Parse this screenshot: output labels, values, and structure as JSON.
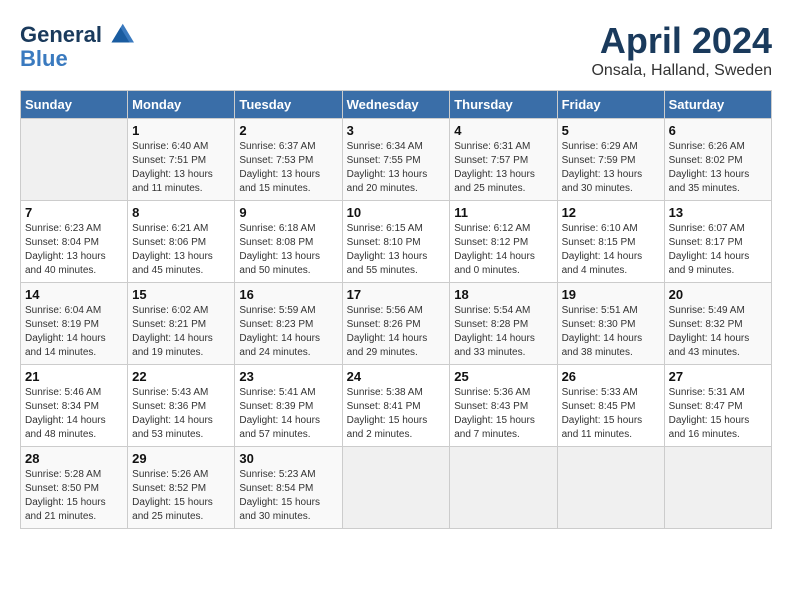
{
  "header": {
    "logo_line1": "General",
    "logo_line2": "Blue",
    "title": "April 2024",
    "location": "Onsala, Halland, Sweden"
  },
  "days_of_week": [
    "Sunday",
    "Monday",
    "Tuesday",
    "Wednesday",
    "Thursday",
    "Friday",
    "Saturday"
  ],
  "weeks": [
    [
      {
        "day": "",
        "sunrise": "",
        "sunset": "",
        "daylight": ""
      },
      {
        "day": "1",
        "sunrise": "6:40 AM",
        "sunset": "7:51 PM",
        "daylight": "13 hours and 11 minutes."
      },
      {
        "day": "2",
        "sunrise": "6:37 AM",
        "sunset": "7:53 PM",
        "daylight": "13 hours and 15 minutes."
      },
      {
        "day": "3",
        "sunrise": "6:34 AM",
        "sunset": "7:55 PM",
        "daylight": "13 hours and 20 minutes."
      },
      {
        "day": "4",
        "sunrise": "6:31 AM",
        "sunset": "7:57 PM",
        "daylight": "13 hours and 25 minutes."
      },
      {
        "day": "5",
        "sunrise": "6:29 AM",
        "sunset": "7:59 PM",
        "daylight": "13 hours and 30 minutes."
      },
      {
        "day": "6",
        "sunrise": "6:26 AM",
        "sunset": "8:02 PM",
        "daylight": "13 hours and 35 minutes."
      }
    ],
    [
      {
        "day": "7",
        "sunrise": "6:23 AM",
        "sunset": "8:04 PM",
        "daylight": "13 hours and 40 minutes."
      },
      {
        "day": "8",
        "sunrise": "6:21 AM",
        "sunset": "8:06 PM",
        "daylight": "13 hours and 45 minutes."
      },
      {
        "day": "9",
        "sunrise": "6:18 AM",
        "sunset": "8:08 PM",
        "daylight": "13 hours and 50 minutes."
      },
      {
        "day": "10",
        "sunrise": "6:15 AM",
        "sunset": "8:10 PM",
        "daylight": "13 hours and 55 minutes."
      },
      {
        "day": "11",
        "sunrise": "6:12 AM",
        "sunset": "8:12 PM",
        "daylight": "14 hours and 0 minutes."
      },
      {
        "day": "12",
        "sunrise": "6:10 AM",
        "sunset": "8:15 PM",
        "daylight": "14 hours and 4 minutes."
      },
      {
        "day": "13",
        "sunrise": "6:07 AM",
        "sunset": "8:17 PM",
        "daylight": "14 hours and 9 minutes."
      }
    ],
    [
      {
        "day": "14",
        "sunrise": "6:04 AM",
        "sunset": "8:19 PM",
        "daylight": "14 hours and 14 minutes."
      },
      {
        "day": "15",
        "sunrise": "6:02 AM",
        "sunset": "8:21 PM",
        "daylight": "14 hours and 19 minutes."
      },
      {
        "day": "16",
        "sunrise": "5:59 AM",
        "sunset": "8:23 PM",
        "daylight": "14 hours and 24 minutes."
      },
      {
        "day": "17",
        "sunrise": "5:56 AM",
        "sunset": "8:26 PM",
        "daylight": "14 hours and 29 minutes."
      },
      {
        "day": "18",
        "sunrise": "5:54 AM",
        "sunset": "8:28 PM",
        "daylight": "14 hours and 33 minutes."
      },
      {
        "day": "19",
        "sunrise": "5:51 AM",
        "sunset": "8:30 PM",
        "daylight": "14 hours and 38 minutes."
      },
      {
        "day": "20",
        "sunrise": "5:49 AM",
        "sunset": "8:32 PM",
        "daylight": "14 hours and 43 minutes."
      }
    ],
    [
      {
        "day": "21",
        "sunrise": "5:46 AM",
        "sunset": "8:34 PM",
        "daylight": "14 hours and 48 minutes."
      },
      {
        "day": "22",
        "sunrise": "5:43 AM",
        "sunset": "8:36 PM",
        "daylight": "14 hours and 53 minutes."
      },
      {
        "day": "23",
        "sunrise": "5:41 AM",
        "sunset": "8:39 PM",
        "daylight": "14 hours and 57 minutes."
      },
      {
        "day": "24",
        "sunrise": "5:38 AM",
        "sunset": "8:41 PM",
        "daylight": "15 hours and 2 minutes."
      },
      {
        "day": "25",
        "sunrise": "5:36 AM",
        "sunset": "8:43 PM",
        "daylight": "15 hours and 7 minutes."
      },
      {
        "day": "26",
        "sunrise": "5:33 AM",
        "sunset": "8:45 PM",
        "daylight": "15 hours and 11 minutes."
      },
      {
        "day": "27",
        "sunrise": "5:31 AM",
        "sunset": "8:47 PM",
        "daylight": "15 hours and 16 minutes."
      }
    ],
    [
      {
        "day": "28",
        "sunrise": "5:28 AM",
        "sunset": "8:50 PM",
        "daylight": "15 hours and 21 minutes."
      },
      {
        "day": "29",
        "sunrise": "5:26 AM",
        "sunset": "8:52 PM",
        "daylight": "15 hours and 25 minutes."
      },
      {
        "day": "30",
        "sunrise": "5:23 AM",
        "sunset": "8:54 PM",
        "daylight": "15 hours and 30 minutes."
      },
      {
        "day": "",
        "sunrise": "",
        "sunset": "",
        "daylight": ""
      },
      {
        "day": "",
        "sunrise": "",
        "sunset": "",
        "daylight": ""
      },
      {
        "day": "",
        "sunrise": "",
        "sunset": "",
        "daylight": ""
      },
      {
        "day": "",
        "sunrise": "",
        "sunset": "",
        "daylight": ""
      }
    ]
  ],
  "labels": {
    "sunrise": "Sunrise:",
    "sunset": "Sunset:",
    "daylight": "Daylight:"
  }
}
